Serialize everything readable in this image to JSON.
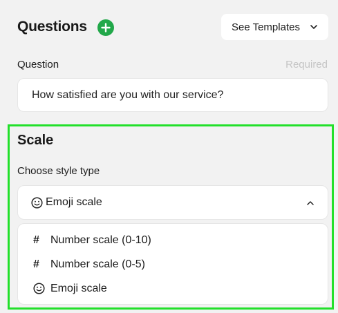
{
  "header": {
    "title": "Questions",
    "add_icon": "plus-circle-icon",
    "templates_label": "See Templates"
  },
  "question": {
    "label": "Question",
    "required": "Required",
    "value": "How satisfied are you with our service?"
  },
  "scale": {
    "title": "Scale",
    "style_label": "Choose style type",
    "selected": "Emoji scale",
    "selected_icon": "smiley-icon",
    "options": [
      {
        "icon": "#",
        "label": "Number scale (0-10)"
      },
      {
        "icon": "#",
        "label": "Number scale (0-5)"
      },
      {
        "icon": "smiley-icon",
        "label": "Emoji scale"
      }
    ]
  },
  "colors": {
    "accent_green": "#22a84a",
    "highlight_border": "#22e02a"
  }
}
